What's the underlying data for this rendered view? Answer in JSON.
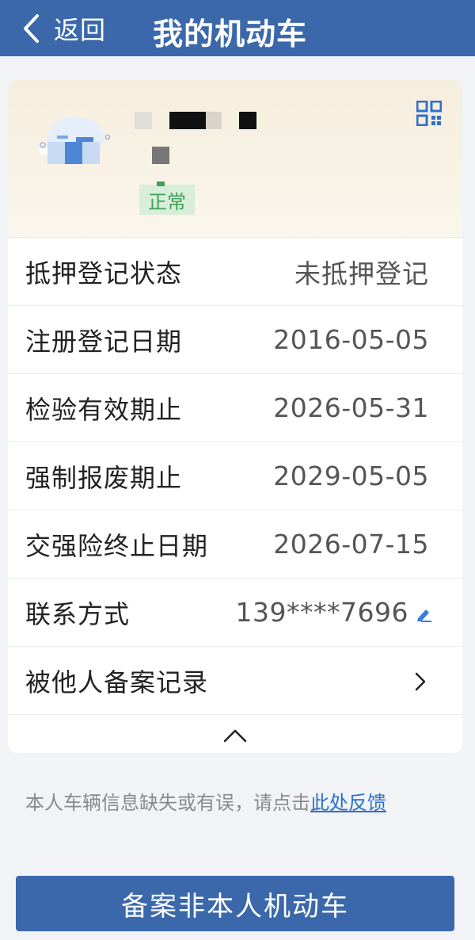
{
  "header": {
    "back_label": "返回",
    "title": "我的机动车"
  },
  "vehicle": {
    "status": "正常"
  },
  "rows": [
    {
      "label": "抵押登记状态",
      "value": "未抵押登记"
    },
    {
      "label": "注册登记日期",
      "value": "2016-05-05"
    },
    {
      "label": "检验有效期止",
      "value": "2026-05-31"
    },
    {
      "label": "强制报废期止",
      "value": "2029-05-05"
    },
    {
      "label": "交强险终止日期",
      "value": "2026-07-15"
    },
    {
      "label": "联系方式",
      "value": "139****7696"
    },
    {
      "label": "被他人备案记录",
      "value": ""
    }
  ],
  "feedback": {
    "text": "本人车辆信息缺失或有误，请点击",
    "link": "此处反馈"
  },
  "bottom_button": "备案非本人机动车",
  "colors": {
    "primary": "#3b68aa",
    "status_green": "#40a05a",
    "link": "#2d6fc8"
  },
  "icons": [
    "back-chevron-icon",
    "qr-code-icon",
    "edit-icon",
    "chevron-right-icon",
    "chevron-up-icon",
    "car-icon"
  ]
}
